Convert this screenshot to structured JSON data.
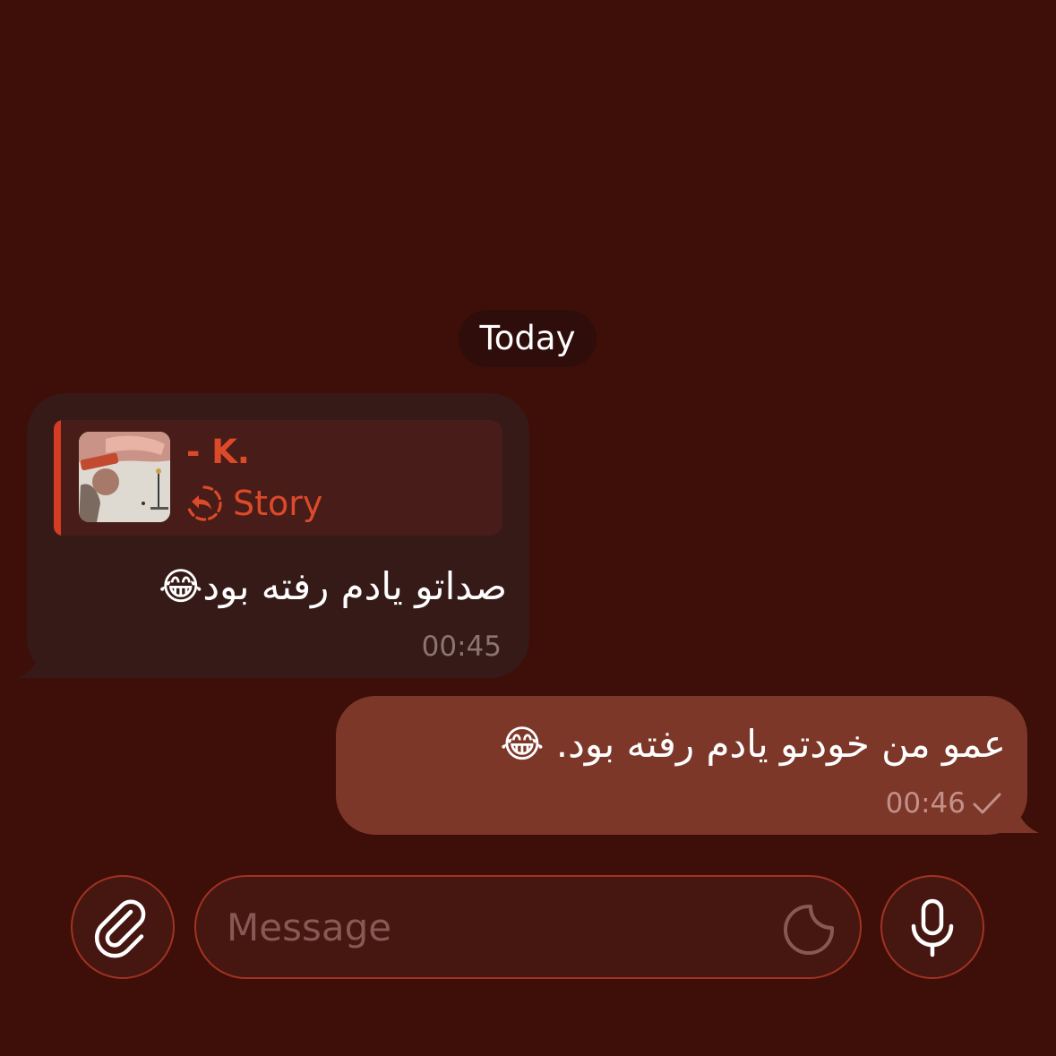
{
  "chat": {
    "date_label": "Today",
    "incoming": {
      "quote_name": "- K.",
      "quote_label": "Story",
      "text": "صداتو یادم رفته بود😂",
      "time": "00:45"
    },
    "outgoing": {
      "text": "عمو من خودتو یادم رفته بود. 😂",
      "time": "00:46",
      "status_icon": "single-check-icon"
    }
  },
  "composer": {
    "placeholder": "Message",
    "value": "",
    "attach_icon": "paperclip-icon",
    "sticker_icon": "sticker-icon",
    "mic_icon": "microphone-icon"
  },
  "colors": {
    "background": "#3e0f09",
    "incoming_bubble": "#351a17",
    "outgoing_bubble": "#7c3729",
    "accent": "#dc4a2a",
    "control_border": "#a13322"
  }
}
